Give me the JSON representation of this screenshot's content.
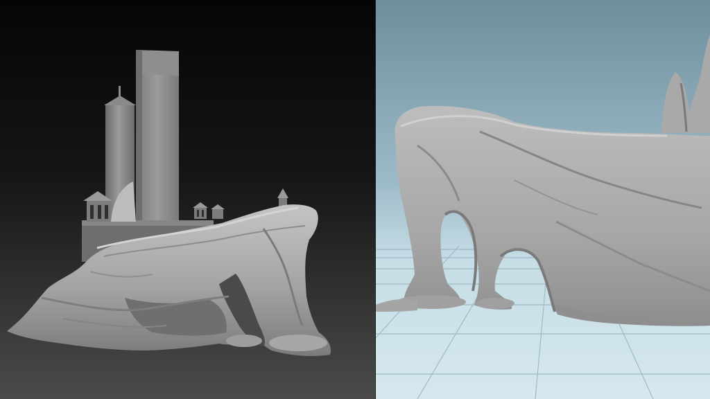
{
  "panels": [
    {
      "view": "left",
      "background": "#0b0b0b",
      "floor_gradient": "#4a4a4a"
    },
    {
      "view": "right",
      "sky_top": "#6f8e9d",
      "sky_bottom": "#cfe3ea",
      "ground": "#cfe6ee"
    }
  ],
  "colors": {
    "stone_light": "#b9b9b9",
    "stone_mid": "#9a9a9a",
    "stone_dark": "#6f6f6f",
    "grid_line": "#9fb9c3"
  }
}
